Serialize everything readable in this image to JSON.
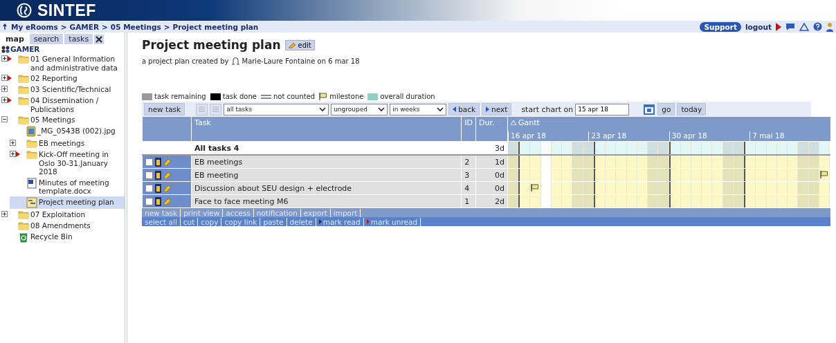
{
  "header": {
    "logo": "SINTEF"
  },
  "breadcrumb": {
    "separator": ">",
    "items": [
      "My eRooms",
      "GAMER",
      "05 Meetings",
      "Project meeting plan"
    ]
  },
  "top_links": {
    "support": "Support",
    "logout": "logout"
  },
  "sidebar": {
    "tabs": [
      {
        "label": "map",
        "selected": true
      },
      {
        "label": "search",
        "selected": false
      },
      {
        "label": "tasks",
        "selected": false
      }
    ],
    "root": {
      "label": "GAMER",
      "children": [
        {
          "label": "01 General Information and administrative data",
          "kind": "folder",
          "expandable": true,
          "expanded": false,
          "unread": true,
          "selected": false
        },
        {
          "label": "02 Reporting",
          "kind": "folder",
          "expandable": true,
          "expanded": false,
          "unread": true,
          "selected": false
        },
        {
          "label": "03 Scientific/Technical",
          "kind": "folder",
          "expandable": true,
          "expanded": false,
          "unread": false,
          "selected": false
        },
        {
          "label": "04 Dissemination / Publications",
          "kind": "folder",
          "expandable": true,
          "expanded": false,
          "unread": true,
          "selected": false
        },
        {
          "label": "05 Meetings",
          "kind": "folder",
          "expandable": true,
          "expanded": true,
          "unread": false,
          "selected": false,
          "children": [
            {
              "label": "_MG_0543B (002).jpg",
              "kind": "image",
              "expandable": false,
              "unread": false,
              "selected": false
            },
            {
              "label": "EB meetings",
              "kind": "folder",
              "expandable": true,
              "expanded": false,
              "unread": false,
              "selected": false
            },
            {
              "label": "Kick-Off meeting in Oslo 30-31.January 2018",
              "kind": "folder",
              "expandable": true,
              "expanded": false,
              "unread": true,
              "selected": false
            },
            {
              "label": "Minutes of meeting template.docx",
              "kind": "document",
              "expandable": false,
              "unread": false,
              "selected": false
            },
            {
              "label": "Project meeting plan",
              "kind": "plan",
              "expandable": false,
              "unread": false,
              "selected": true
            }
          ]
        },
        {
          "label": "07 Exploitation",
          "kind": "folder",
          "expandable": true,
          "expanded": false,
          "unread": false,
          "selected": false
        },
        {
          "label": "08 Amendments",
          "kind": "folder",
          "expandable": false,
          "unread": false,
          "selected": false
        },
        {
          "label": "Recycle Bin",
          "kind": "recycle",
          "expandable": false,
          "unread": false,
          "selected": false
        }
      ]
    }
  },
  "page": {
    "title": "Project meeting plan",
    "edit_button": "edit",
    "byline_prefix": "a project plan created by",
    "byline_rest": "Marie-Laure Fontaine on 6 mar 18"
  },
  "legend": [
    {
      "kind": "remaining",
      "label": "task remaining"
    },
    {
      "kind": "done",
      "label": "task done"
    },
    {
      "kind": "not_counted",
      "label": "not counted"
    },
    {
      "kind": "milestone",
      "label": "milestone"
    },
    {
      "kind": "overall",
      "label": "overall duration"
    }
  ],
  "toolbar": {
    "new_task": "new task",
    "view_icons": [
      {
        "disabled": true
      },
      {
        "disabled": true
      }
    ],
    "filter": "all tasks",
    "grouping": "ungrouped",
    "scale": "in weeks",
    "back": "back",
    "next": "next",
    "start_label": "start chart on",
    "start_date": "15 apr 18",
    "go": "go",
    "today": "today"
  },
  "table": {
    "columns": [
      "Task",
      "ID",
      "Dur."
    ],
    "gantt_label": "Gantt",
    "days": [
      {
        "kind": "weekend"
      },
      {
        "kind": "weekday",
        "label": "16 apr 18"
      },
      {
        "kind": "weekday"
      },
      {
        "kind": "today"
      },
      {
        "kind": "weekday"
      },
      {
        "kind": "weekday"
      },
      {
        "kind": "weekend"
      },
      {
        "kind": "weekend"
      },
      {
        "kind": "weekday",
        "label": "23 apr 18"
      },
      {
        "kind": "weekday"
      },
      {
        "kind": "weekday"
      },
      {
        "kind": "weekday"
      },
      {
        "kind": "weekday"
      },
      {
        "kind": "weekend"
      },
      {
        "kind": "weekend"
      },
      {
        "kind": "weekday",
        "label": "30 apr 18"
      },
      {
        "kind": "weekday"
      },
      {
        "kind": "weekday"
      },
      {
        "kind": "weekday"
      },
      {
        "kind": "weekday"
      },
      {
        "kind": "weekend"
      },
      {
        "kind": "weekend"
      },
      {
        "kind": "weekday",
        "label": "7 mai 18"
      },
      {
        "kind": "weekday"
      },
      {
        "kind": "weekday"
      },
      {
        "kind": "weekday"
      },
      {
        "kind": "weekday"
      },
      {
        "kind": "weekend"
      },
      {
        "kind": "weekend"
      },
      {
        "kind": "weekday"
      }
    ],
    "summary": {
      "task": "All tasks 4",
      "duration": "3d"
    },
    "rows": [
      {
        "task": "EB meetings",
        "id": "2",
        "duration": "1d",
        "checked": false
      },
      {
        "task": "EB meeting",
        "id": "3",
        "duration": "0d",
        "checked": false,
        "flags": [
          false,
          false,
          false,
          false,
          false,
          false,
          false,
          false,
          false,
          false,
          false,
          false,
          false,
          false,
          false,
          false,
          false,
          false,
          false,
          false,
          false,
          false,
          false,
          false,
          false,
          false,
          false,
          false,
          false,
          true
        ]
      },
      {
        "task": "Discussion about SEU design + electrode",
        "id": "4",
        "duration": "0d",
        "checked": false,
        "flags": [
          false,
          false,
          true,
          false,
          false,
          false,
          false,
          false,
          false,
          false,
          false,
          false,
          false,
          false,
          false,
          false,
          false,
          false,
          false,
          false,
          false,
          false,
          false,
          false,
          false,
          false,
          false,
          false,
          false,
          false
        ]
      },
      {
        "task": "Face to face meeting M6",
        "id": "1",
        "duration": "2d",
        "checked": false
      }
    ],
    "actions": [
      "new task",
      "print view",
      "access",
      "notification",
      "export",
      "import"
    ],
    "selection_actions": [
      {
        "label": "select all",
        "kind": "plain"
      },
      {
        "label": "cut",
        "kind": "plain"
      },
      {
        "label": "copy",
        "kind": "plain"
      },
      {
        "label": "copy link",
        "kind": "plain"
      },
      {
        "label": "paste",
        "kind": "plain"
      },
      {
        "label": "delete",
        "kind": "plain"
      },
      {
        "label": "mark read",
        "kind": "read"
      },
      {
        "label": "mark unread",
        "kind": "unread"
      }
    ]
  }
}
